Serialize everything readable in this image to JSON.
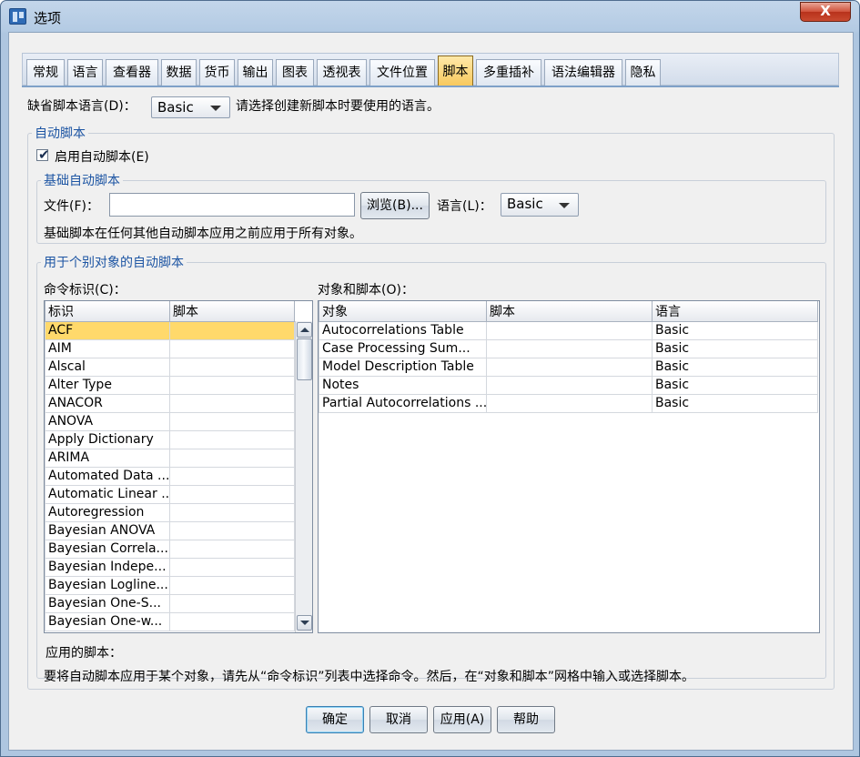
{
  "window": {
    "title": "选项",
    "close_label": "X"
  },
  "tabs": [
    {
      "label": "常规"
    },
    {
      "label": "语言"
    },
    {
      "label": "查看器"
    },
    {
      "label": "数据"
    },
    {
      "label": "货币"
    },
    {
      "label": "输出"
    },
    {
      "label": "图表"
    },
    {
      "label": "透视表"
    },
    {
      "label": "文件位置"
    },
    {
      "label": "脚本",
      "active": true
    },
    {
      "label": "多重插补"
    },
    {
      "label": "语法编辑器"
    },
    {
      "label": "隐私"
    }
  ],
  "default_language": {
    "label": "缺省脚本语言(D)：",
    "value": "Basic",
    "hint": "请选择创建新脚本时要使用的语言。"
  },
  "autoscript": {
    "legend": "自动脚本",
    "enable_label": "启用自动脚本(E)",
    "enable_checked": true,
    "base": {
      "legend": "基础自动脚本",
      "file_label": "文件(F)：",
      "file_value": "",
      "browse_label": "浏览(B)...",
      "language_label": "语言(L)：",
      "language_value": "Basic",
      "note": "基础脚本在任何其他自动脚本应用之前应用于所有对象。"
    },
    "individual": {
      "legend": "用于个别对象的自动脚本",
      "command_label": "命令标识(C)：",
      "objects_label": "对象和脚本(O)：",
      "command_headers": [
        "标识",
        "脚本"
      ],
      "commands": [
        "ACF",
        "AIM",
        "Alscal",
        "Alter Type",
        "ANACOR",
        "ANOVA",
        "Apply Dictionary",
        "ARIMA",
        "Automated Data ...",
        "Automatic Linear ...",
        "Autoregression",
        "Bayesian ANOVA",
        "Bayesian Correla...",
        "Bayesian Indepe...",
        "Bayesian Logline...",
        "Bayesian One-S...",
        "Bayesian One-w..."
      ],
      "object_headers": [
        "对象",
        "脚本",
        "语言"
      ],
      "objects": [
        {
          "object": "Autocorrelations Table",
          "script": "",
          "language": "Basic"
        },
        {
          "object": "Case Processing Sum...",
          "script": "",
          "language": "Basic"
        },
        {
          "object": "Model Description Table",
          "script": "",
          "language": "Basic"
        },
        {
          "object": "Notes",
          "script": "",
          "language": "Basic"
        },
        {
          "object": "Partial Autocorrelations ...",
          "script": "",
          "language": "Basic"
        }
      ],
      "applied_label": "应用的脚本：",
      "instruction": "要将自动脚本应用于某个对象，请先从“命令标识”列表中选择命令。然后，在“对象和脚本”网格中输入或选择脚本。"
    }
  },
  "buttons": {
    "ok": "确定",
    "cancel": "取消",
    "apply": "应用(A)",
    "help": "帮助"
  },
  "colors": {
    "accent": "#f7c85c",
    "selection": "#ffd96b",
    "legend": "#1d55a3"
  }
}
